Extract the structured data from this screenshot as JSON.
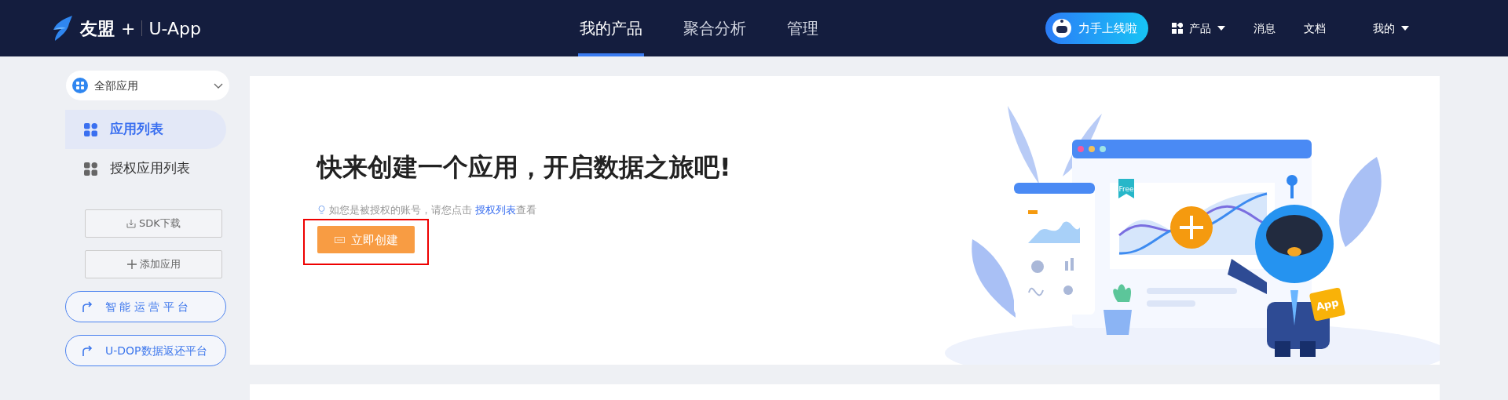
{
  "header": {
    "logo_brand": "友盟",
    "logo_plus": "+",
    "logo_product": "U-App",
    "nav": [
      {
        "label": "我的产品",
        "selected": true
      },
      {
        "label": "聚合分析",
        "selected": false
      },
      {
        "label": "管理",
        "selected": false
      }
    ],
    "promo_button": "力手上线啦",
    "links": [
      {
        "label": "产品",
        "kind": "menu"
      },
      {
        "label": "消息",
        "kind": "plain"
      },
      {
        "label": "文档",
        "kind": "plain"
      },
      {
        "label": "我的",
        "kind": "dropdown"
      }
    ]
  },
  "sidebar": {
    "app_select": {
      "value": "全部应用"
    },
    "items": [
      {
        "label": "应用列表",
        "selected": true
      },
      {
        "label": "授权应用列表",
        "selected": false
      }
    ],
    "buttons": [
      {
        "label": "SDK下载",
        "kind": "download"
      },
      {
        "label": "添加应用",
        "kind": "add"
      }
    ],
    "platform_links": [
      {
        "label": "智 能 运 营 平 台"
      },
      {
        "label": "U-DOP数据返还平台"
      }
    ]
  },
  "main": {
    "title": "快来创建一个应用，开启数据之旅吧!",
    "hint": {
      "text": "如您是被授权的账号，请您点击",
      "link": "授权列表",
      "suffix": "查看"
    },
    "create_button": {
      "label": "立即创建",
      "highlighted": true
    },
    "illustration": {
      "tag": "Free",
      "badge": "App"
    }
  }
}
